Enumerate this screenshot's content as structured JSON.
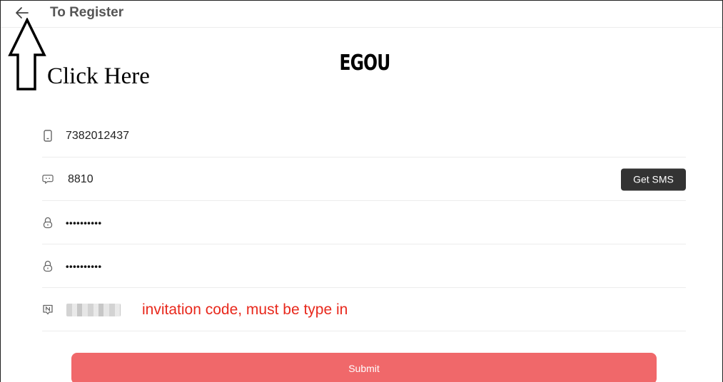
{
  "header": {
    "title": "To Register",
    "back_icon": "arrow-left-icon"
  },
  "annotation": {
    "text": "Click Here"
  },
  "logo": {
    "text": "EGOU"
  },
  "form": {
    "phone": {
      "value": "7382012437",
      "icon": "phone-icon"
    },
    "sms_code": {
      "value": "8810",
      "icon": "message-icon",
      "button_label": "Get SMS"
    },
    "password": {
      "value": "••••••••••",
      "icon": "lock-icon"
    },
    "confirm_password": {
      "value": "••••••••••",
      "icon": "lock-icon"
    },
    "invite": {
      "icon": "invite-icon",
      "note": "invitation code, must be type in"
    }
  },
  "submit_label": "Submit",
  "colors": {
    "submit": "#f0686a",
    "sms_button": "#333333",
    "note": "#e8281c"
  }
}
